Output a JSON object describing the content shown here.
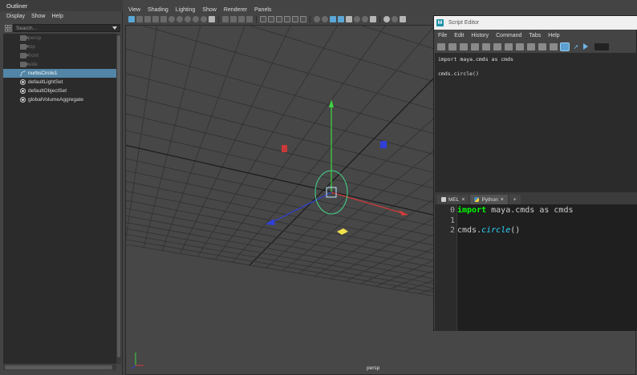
{
  "outliner": {
    "title": "Outliner",
    "menu": [
      "Display",
      "Show",
      "Help"
    ],
    "search_placeholder": "Search...",
    "items": [
      {
        "label": "persp",
        "icon": "camera-icon",
        "dim": true,
        "selected": false
      },
      {
        "label": "top",
        "icon": "camera-icon",
        "dim": true,
        "selected": false
      },
      {
        "label": "front",
        "icon": "camera-icon",
        "dim": true,
        "selected": false
      },
      {
        "label": "side",
        "icon": "camera-icon",
        "dim": true,
        "selected": false
      },
      {
        "label": "nurbsCircle1",
        "icon": "nurbs-curve-icon",
        "dim": false,
        "selected": true
      },
      {
        "label": "defaultLightSet",
        "icon": "set-icon",
        "dim": false,
        "selected": false
      },
      {
        "label": "defaultObjectSet",
        "icon": "set-icon",
        "dim": false,
        "selected": false
      },
      {
        "label": "globalVolumeAggregate",
        "icon": "set-icon",
        "dim": false,
        "selected": false
      }
    ]
  },
  "viewport": {
    "menu": [
      "View",
      "Shading",
      "Lighting",
      "Show",
      "Renderer",
      "Panels"
    ],
    "camera_label": "persp"
  },
  "script_editor": {
    "title": "Script Editor",
    "menu": [
      "File",
      "Edit",
      "History",
      "Command",
      "Tabs",
      "Help"
    ],
    "history_lines": [
      "import maya.cmds as cmds",
      "",
      "cmds.circle()"
    ],
    "tabs": [
      {
        "label": "MEL",
        "close": "×",
        "icon": "mel-icon"
      },
      {
        "label": "Python",
        "close": "×",
        "icon": "python-icon"
      }
    ],
    "add_tab": "+",
    "line_numbers": [
      "0",
      "1",
      "2"
    ],
    "code": {
      "line0_keyword": "import",
      "line0_rest": " maya.cmds as cmds",
      "line2_obj": "cmds.",
      "line2_fn": "circle",
      "line2_tail": "()"
    },
    "colors": {
      "keyword": "#00ff00",
      "function": "#2fd6ff"
    }
  },
  "colors": {
    "selection": "#5285a6",
    "panel": "#444444",
    "field": "#2b2b2b",
    "accent": "#5aa6d6"
  }
}
